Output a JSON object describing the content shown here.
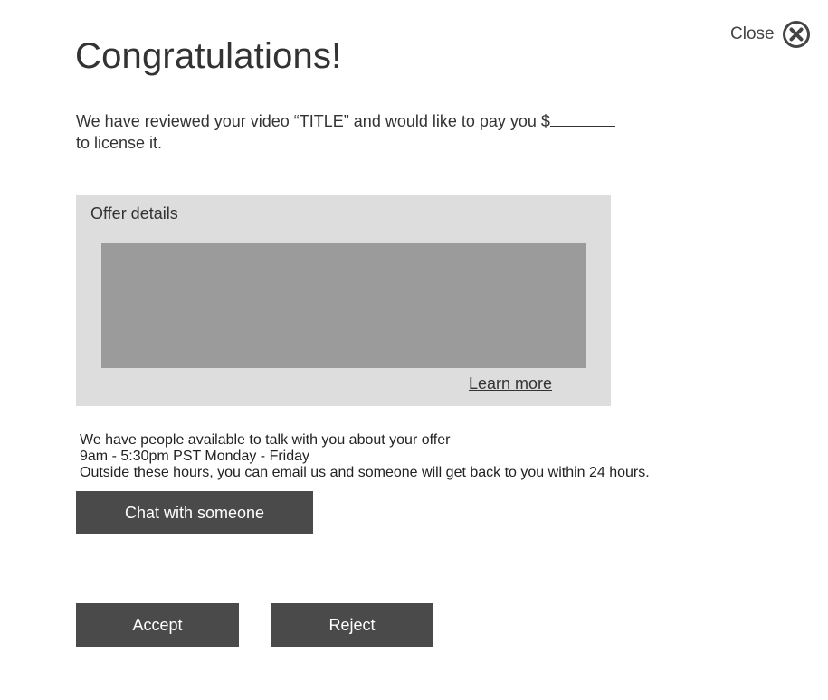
{
  "close": {
    "label": "Close",
    "icon": "close-circle-icon"
  },
  "title": "Congratulations!",
  "intro": {
    "text_before": "We have reviewed your video “TITLE” and would like to pay you $",
    "text_after": "to license it."
  },
  "offer": {
    "title": "Offer details",
    "learn_more": "Learn more"
  },
  "contact": {
    "line1": "We have people available to talk with you about your offer",
    "line2": "9am - 5:30pm PST Monday - Friday",
    "line3_before": "Outside these hours, you can ",
    "line3_link": "email us",
    "line3_after": " and someone will get back to you within 24 hours."
  },
  "buttons": {
    "chat": "Chat with someone",
    "accept": "Accept",
    "reject": "Reject"
  },
  "colors": {
    "button_bg": "#4a4a4a",
    "offer_box_bg": "#dddddd",
    "offer_content_bg": "#9b9b9b"
  }
}
